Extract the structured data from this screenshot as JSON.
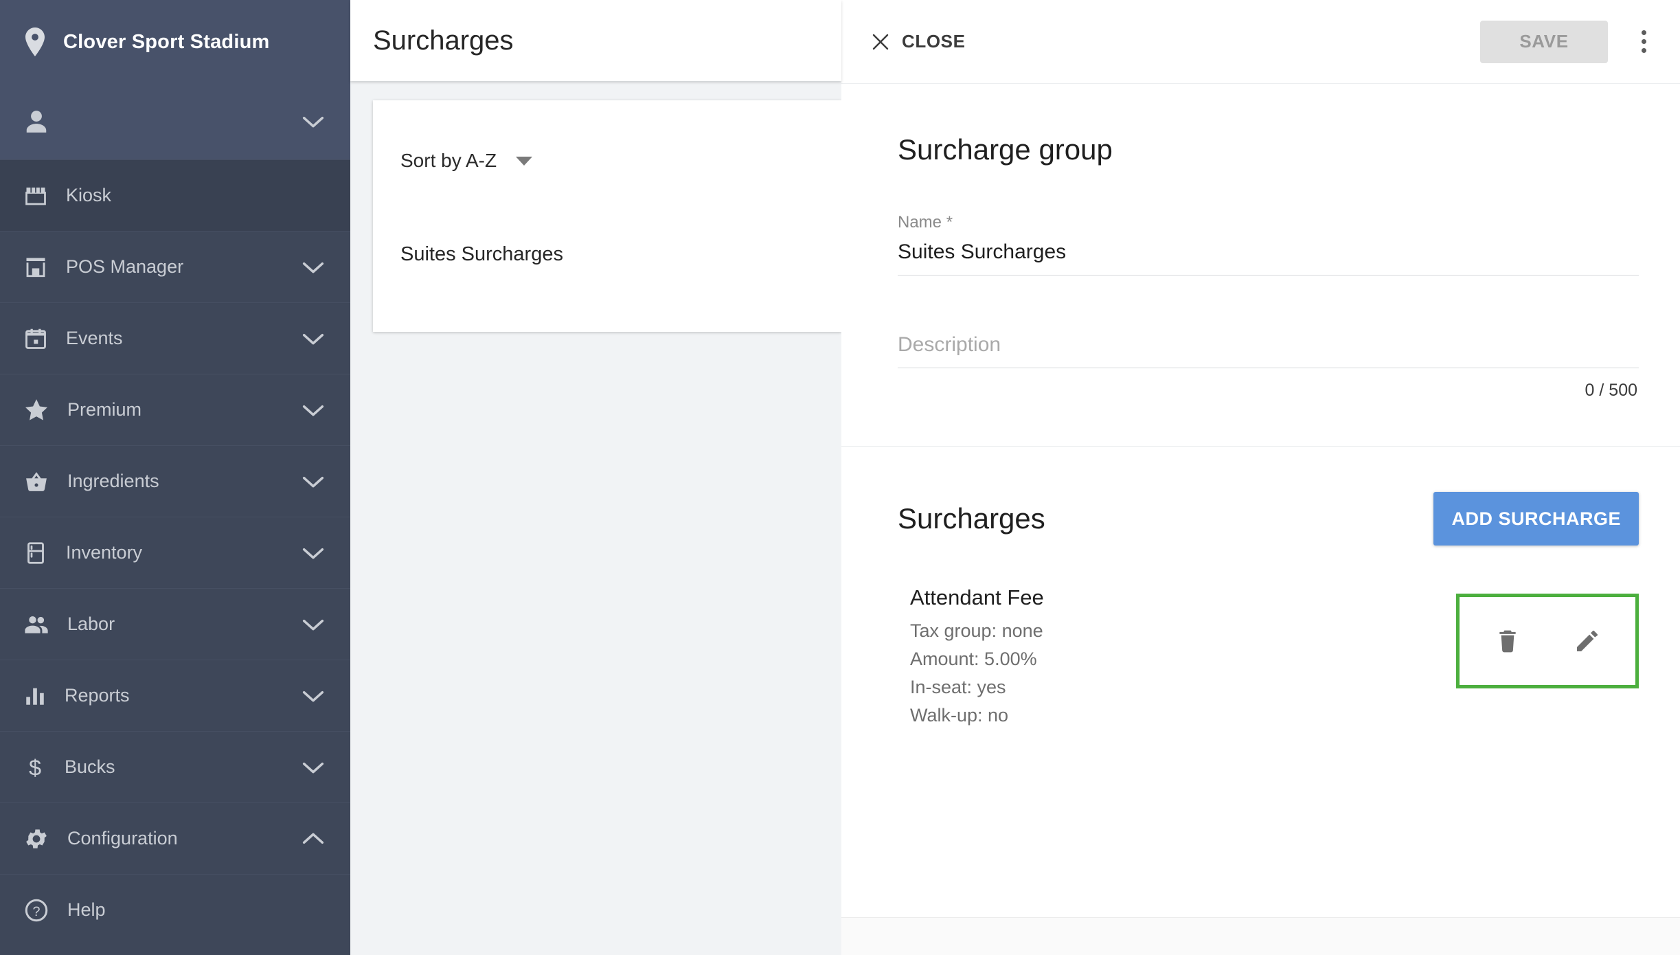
{
  "sidebar": {
    "venue": {
      "name": "Clover Sport Stadium",
      "icon": "location-pin-icon"
    },
    "user": {
      "icon": "person-icon",
      "chevron": "chevron-down-icon"
    },
    "items": [
      {
        "label": "Kiosk",
        "icon": "storefront-icon",
        "chevron": null,
        "active": true
      },
      {
        "label": "POS Manager",
        "icon": "store-icon",
        "chevron": "chevron-down-icon",
        "active": false
      },
      {
        "label": "Events",
        "icon": "calendar-icon",
        "chevron": "chevron-down-icon",
        "active": false
      },
      {
        "label": "Premium",
        "icon": "star-icon",
        "chevron": "chevron-down-icon",
        "active": false
      },
      {
        "label": "Ingredients",
        "icon": "basket-icon",
        "chevron": "chevron-down-icon",
        "active": false
      },
      {
        "label": "Inventory",
        "icon": "fridge-icon",
        "chevron": "chevron-down-icon",
        "active": false
      },
      {
        "label": "Labor",
        "icon": "people-icon",
        "chevron": "chevron-down-icon",
        "active": false
      },
      {
        "label": "Reports",
        "icon": "bar-chart-icon",
        "chevron": "chevron-down-icon",
        "active": false
      },
      {
        "label": "Bucks",
        "icon": "dollar-icon",
        "chevron": "chevron-down-icon",
        "active": false
      },
      {
        "label": "Configuration",
        "icon": "gear-icon",
        "chevron": "chevron-up-icon",
        "active": false
      },
      {
        "label": "Help",
        "icon": "help-circle-icon",
        "chevron": null,
        "active": false
      }
    ]
  },
  "list_panel": {
    "title": "Surcharges",
    "sort": {
      "label": "Sort by A-Z",
      "icon": "caret-down-icon"
    },
    "items": [
      "Suites Surcharges"
    ]
  },
  "detail": {
    "header": {
      "close_label": "CLOSE",
      "close_icon": "close-x-icon",
      "save_label": "SAVE",
      "save_disabled": true,
      "kebab_icon": "more-vertical-icon"
    },
    "group": {
      "heading": "Surcharge group",
      "name_label": "Name *",
      "name_value": "Suites Surcharges",
      "description_placeholder": "Description",
      "description_value": "",
      "counter": "0 / 500"
    },
    "surcharges": {
      "heading": "Surcharges",
      "add_button": "ADD SURCHARGE",
      "rows": [
        {
          "name": "Attendant Fee",
          "tax_group": "Tax group: none",
          "amount": "Amount: 5.00%",
          "in_seat": "In-seat: yes",
          "walk_up": "Walk-up: no",
          "delete_icon": "trash-icon",
          "edit_icon": "pencil-icon",
          "highlighted": true
        }
      ]
    }
  },
  "colors": {
    "sidebar_bg": "#3e4759",
    "sidebar_header_bg": "#48526a",
    "sidebar_active_bg": "#394152",
    "accent_blue": "#5b93dd",
    "highlight_green": "#4caf3e",
    "list_bg": "#f1f3f5"
  }
}
